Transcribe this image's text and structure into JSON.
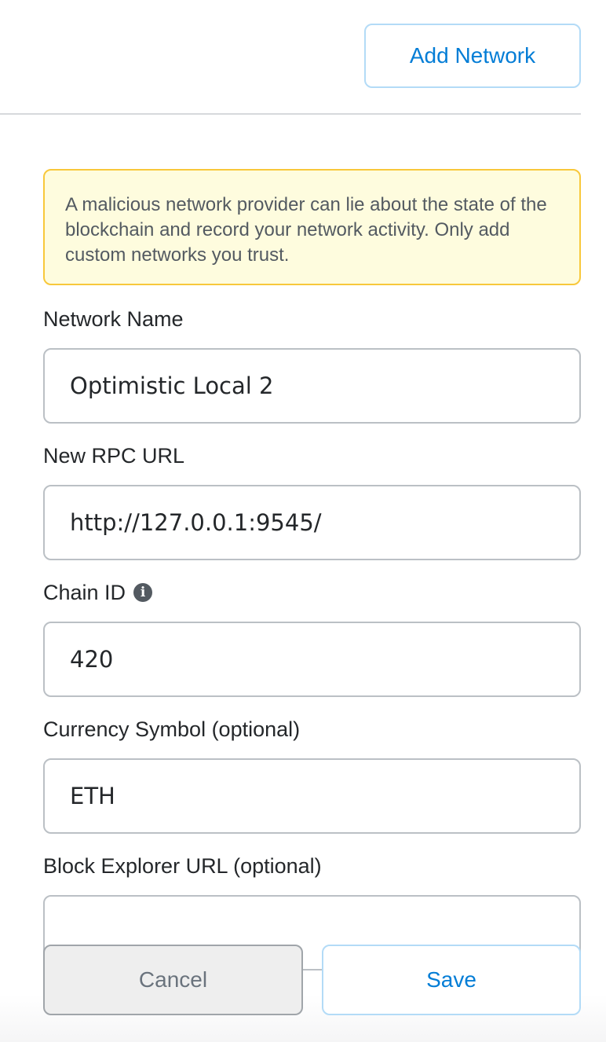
{
  "header": {
    "add_network_label": "Add Network"
  },
  "warning": {
    "text": "A malicious network provider can lie about the state of the blockchain and record your network activity. Only add custom networks you trust."
  },
  "form": {
    "network_name": {
      "label": "Network Name",
      "value": "Optimistic Local 2"
    },
    "rpc_url": {
      "label": "New RPC URL",
      "value": "http://127.0.0.1:9545/"
    },
    "chain_id": {
      "label": "Chain ID",
      "icon": "info-icon",
      "value": "420"
    },
    "currency_symbol": {
      "label": "Currency Symbol (optional)",
      "value": "ETH"
    },
    "block_explorer": {
      "label": "Block Explorer URL (optional)",
      "value": ""
    }
  },
  "footer": {
    "cancel_label": "Cancel",
    "save_label": "Save"
  },
  "colors": {
    "accent": "#037dd6",
    "warning_bg": "#fefcde",
    "warning_border": "#f8c83b"
  }
}
